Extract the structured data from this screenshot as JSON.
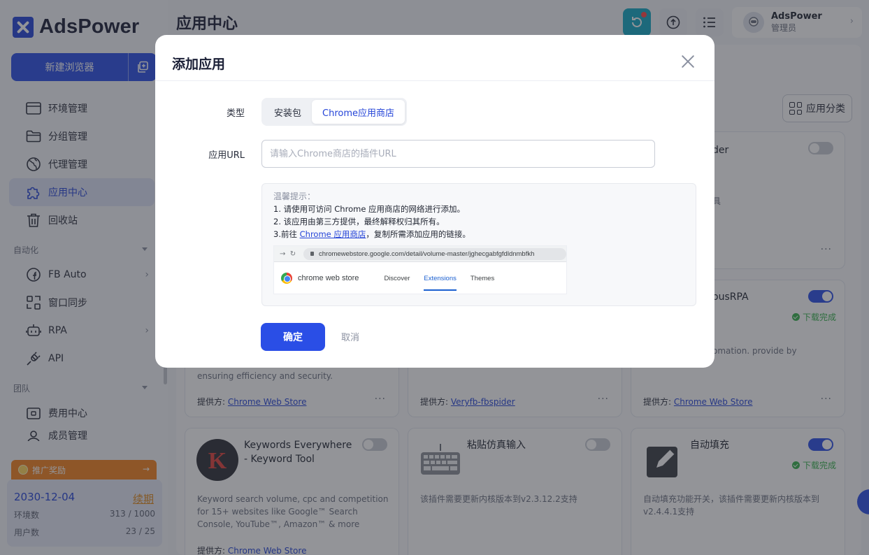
{
  "app": {
    "logo_text": "AdsPower",
    "new_browser_label": "新建浏览器"
  },
  "sidebar": {
    "items": [
      {
        "label": "环境管理",
        "icon": "browser-window-icon"
      },
      {
        "label": "分组管理",
        "icon": "folder-icon"
      },
      {
        "label": "代理管理",
        "icon": "globe-icon"
      },
      {
        "label": "应用中心",
        "icon": "puzzle-icon",
        "active": true
      },
      {
        "label": "回收站",
        "icon": "trash-icon"
      }
    ],
    "section_automation": "自动化",
    "automation_items": [
      {
        "label": "FB Auto",
        "icon": "facebook-icon",
        "has_arrow": true
      },
      {
        "label": "窗口同步",
        "icon": "sync-window-icon"
      },
      {
        "label": "RPA",
        "icon": "robot-icon",
        "has_arrow": true
      },
      {
        "label": "API",
        "icon": "plug-icon"
      }
    ],
    "section_team": "团队",
    "team_items": [
      {
        "label": "费用中心",
        "icon": "wallet-icon"
      },
      {
        "label": "成员管理",
        "icon": "member-icon"
      }
    ],
    "promo_label": "推广奖励",
    "promo_arrow": "→",
    "plan": {
      "expiry": "2030-12-04",
      "renew_label": "续期",
      "env_label": "环境数",
      "env_value": "313 / 1000",
      "user_label": "用户数",
      "user_value": "23 / 25"
    }
  },
  "header": {
    "page_title": "应用中心",
    "user_name": "AdsPower",
    "user_role": "管理员"
  },
  "toolbar": {
    "category_label": "应用分类"
  },
  "cards": [
    {
      "title_fragment": "der",
      "desc_fragment": "具",
      "toggle_on": false
    },
    {
      "title_fragment": "ousRPA",
      "desc_fragment": "omation. provide by",
      "toggle_on": true,
      "status": "下载完成"
    },
    {
      "desc": "ensuring efficiency and security.",
      "provider_label": "提供方:",
      "provider": "Chrome Web Store"
    },
    {
      "provider_label": "提供方:",
      "provider": "Veryfb-fbspider"
    },
    {
      "provider_label": "提供方:",
      "provider": "Chrome Web Store"
    },
    {
      "title": "Keywords Everywhere - Keyword Tool",
      "desc": "Keyword search volume, cpc and competition for 15+ websites like Google™ Search Console, YouTube™, Amazon™ & more",
      "toggle_on": false,
      "provider_label": "提供方:",
      "provider": "Chrome Web Store"
    },
    {
      "title": "粘贴仿真输入",
      "desc": "该插件需要更新内核版本到v2.3.12.2支持",
      "toggle_on": false
    },
    {
      "title": "自动填充",
      "desc": "自动填充功能开关，该插件需要更新内核版本到v2.4.4.1支持",
      "toggle_on": true,
      "status": "下载完成"
    }
  ],
  "modal": {
    "title": "添加应用",
    "type_label": "类型",
    "type_options": [
      "安装包",
      "Chrome应用商店"
    ],
    "type_selected": "Chrome应用商店",
    "url_label": "应用URL",
    "url_placeholder": "请输入Chrome商店的插件URL",
    "url_value": "",
    "tip_title": "温馨提示：",
    "tip_line1": "1. 请使用可访问 Chrome 应用商店的网络进行添加。",
    "tip_line2": "2. 该应用由第三方提供，最终解释权归其所有。",
    "tip_line3_prefix": "3.前往 ",
    "tip_line3_link": "Chrome 应用商店",
    "tip_line3_suffix": "，复制所需添加应用的链接。",
    "example_url": "chromewebstore.google.com/detail/volume-master/jghecgabfgfdldnmbfkh",
    "example_store_name": "chrome web store",
    "example_tabs": [
      "Discover",
      "Extensions",
      "Themes"
    ],
    "example_tab_selected": "Extensions",
    "confirm_label": "确定",
    "cancel_label": "取消"
  },
  "colors": {
    "primary": "#2a4ee6",
    "success": "#37b24d",
    "promo": "#f4831f",
    "renew": "#e08a1d"
  }
}
